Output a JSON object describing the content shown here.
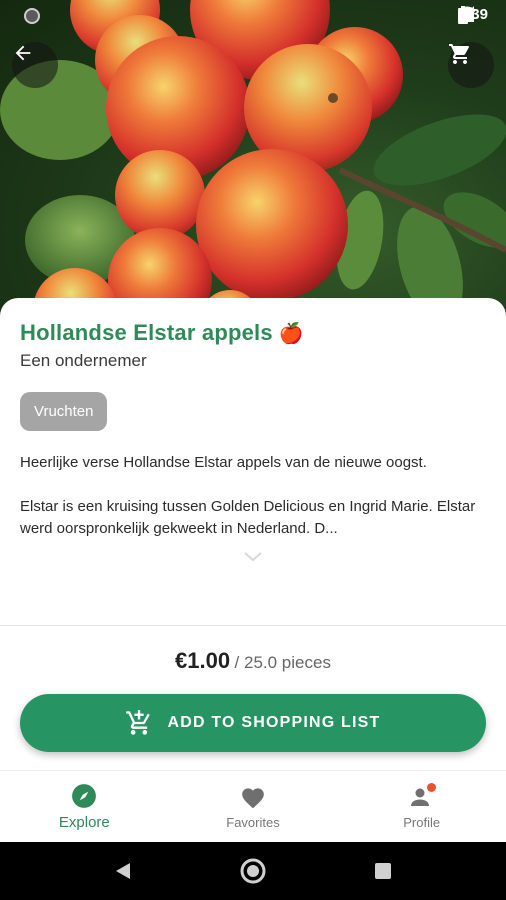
{
  "status_bar": {
    "time": "9:39"
  },
  "product": {
    "title": "Hollandse Elstar appels",
    "emoji": "🍎",
    "seller": "Een ondernemer",
    "category": "Vruchten",
    "description": [
      "Heerlijke verse Hollandse Elstar appels van de nieuwe oogst.",
      "Elstar is een kruising tussen Golden Delicious en Ingrid Marie. Elstar werd oorspronkelijk gekweekt in Nederland. D..."
    ],
    "price": "€1.00",
    "unit": "/ 25.0 pieces"
  },
  "actions": {
    "add_to_list": "ADD TO SHOPPING LIST"
  },
  "bottom_nav": {
    "items": [
      {
        "label": "Explore",
        "icon": "compass-icon",
        "active": true
      },
      {
        "label": "Favorites",
        "icon": "heart-icon",
        "active": false
      },
      {
        "label": "Profile",
        "icon": "person-icon",
        "active": false
      }
    ]
  },
  "colors": {
    "accent": "#279563",
    "title": "#2e8b57",
    "chip": "#a5a5a5",
    "notification": "#f0502e"
  }
}
